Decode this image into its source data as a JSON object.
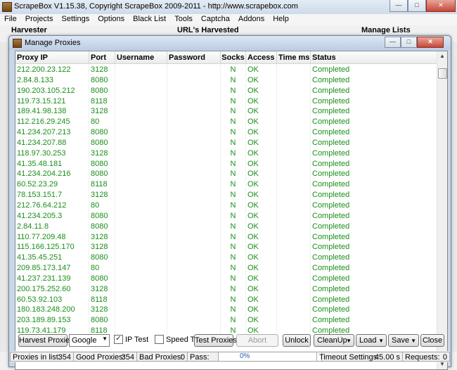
{
  "window": {
    "title": "ScrapeBox V1.15.38, Copyright ScrapeBox 2009-2011 - http://www.scrapebox.com",
    "controls": {
      "minimize": "—",
      "maximize": "□",
      "close": "✕"
    }
  },
  "menu": [
    "File",
    "Projects",
    "Settings",
    "Options",
    "Black List",
    "Tools",
    "Captcha",
    "Addons",
    "Help"
  ],
  "background_panels": {
    "harvester": "Harvester",
    "urls_harvested": "URL's Harvested",
    "manage_lists": "Manage Lists"
  },
  "dialog": {
    "title": "Manage Proxies",
    "controls": {
      "minimize": "—",
      "maximize": "□",
      "close": "✕"
    },
    "columns": [
      "Proxy IP",
      "Port",
      "Username",
      "Password",
      "Socks",
      "Access",
      "Time ms",
      "Status"
    ],
    "rows": [
      {
        "ip": "212.200.23.122",
        "port": "3128",
        "socks": "N",
        "access": "OK",
        "status": "Completed"
      },
      {
        "ip": "2.84.8.133",
        "port": "8080",
        "socks": "N",
        "access": "OK",
        "status": "Completed"
      },
      {
        "ip": "190.203.105.212",
        "port": "8080",
        "socks": "N",
        "access": "OK",
        "status": "Completed"
      },
      {
        "ip": "119.73.15.121",
        "port": "8118",
        "socks": "N",
        "access": "OK",
        "status": "Completed"
      },
      {
        "ip": "189.41.98.138",
        "port": "3128",
        "socks": "N",
        "access": "OK",
        "status": "Completed"
      },
      {
        "ip": "112.216.29.245",
        "port": "80",
        "socks": "N",
        "access": "OK",
        "status": "Completed"
      },
      {
        "ip": "41.234.207.213",
        "port": "8080",
        "socks": "N",
        "access": "OK",
        "status": "Completed"
      },
      {
        "ip": "41.234.207.88",
        "port": "8080",
        "socks": "N",
        "access": "OK",
        "status": "Completed"
      },
      {
        "ip": "118.97.30.253",
        "port": "3128",
        "socks": "N",
        "access": "OK",
        "status": "Completed"
      },
      {
        "ip": "41.35.48.181",
        "port": "8080",
        "socks": "N",
        "access": "OK",
        "status": "Completed"
      },
      {
        "ip": "41.234.204.216",
        "port": "8080",
        "socks": "N",
        "access": "OK",
        "status": "Completed"
      },
      {
        "ip": "60.52.23.29",
        "port": "8118",
        "socks": "N",
        "access": "OK",
        "status": "Completed"
      },
      {
        "ip": "78.153.151.7",
        "port": "3128",
        "socks": "N",
        "access": "OK",
        "status": "Completed"
      },
      {
        "ip": "212.76.64.212",
        "port": "80",
        "socks": "N",
        "access": "OK",
        "status": "Completed"
      },
      {
        "ip": "41.234.205.3",
        "port": "8080",
        "socks": "N",
        "access": "OK",
        "status": "Completed"
      },
      {
        "ip": "2.84.11.8",
        "port": "8080",
        "socks": "N",
        "access": "OK",
        "status": "Completed"
      },
      {
        "ip": "110.77.209.48",
        "port": "3128",
        "socks": "N",
        "access": "OK",
        "status": "Completed"
      },
      {
        "ip": "115.166.125.170",
        "port": "3128",
        "socks": "N",
        "access": "OK",
        "status": "Completed"
      },
      {
        "ip": "41.35.45.251",
        "port": "8080",
        "socks": "N",
        "access": "OK",
        "status": "Completed"
      },
      {
        "ip": "209.85.173.147",
        "port": "80",
        "socks": "N",
        "access": "OK",
        "status": "Completed"
      },
      {
        "ip": "41.237.231.139",
        "port": "8080",
        "socks": "N",
        "access": "OK",
        "status": "Completed"
      },
      {
        "ip": "200.175.252.60",
        "port": "3128",
        "socks": "N",
        "access": "OK",
        "status": "Completed"
      },
      {
        "ip": "60.53.92.103",
        "port": "8118",
        "socks": "N",
        "access": "OK",
        "status": "Completed"
      },
      {
        "ip": "180.183.248.200",
        "port": "3128",
        "socks": "N",
        "access": "OK",
        "status": "Completed"
      },
      {
        "ip": "203.189.89.153",
        "port": "8080",
        "socks": "N",
        "access": "OK",
        "status": "Completed"
      },
      {
        "ip": "119.73.41.179",
        "port": "8118",
        "socks": "N",
        "access": "OK",
        "status": "Completed"
      }
    ],
    "toolbar": {
      "harvest": "Harvest Proxies",
      "engine_select": "Google",
      "ip_test": "IP Test",
      "ip_test_checked": true,
      "speed_test": "Speed Test",
      "speed_test_checked": false,
      "test_proxies": "Test Proxies",
      "abort": "Abort",
      "unlock": "Unlock",
      "cleanup": "CleanUp",
      "load": "Load",
      "save": "Save",
      "close": "Close"
    },
    "status": {
      "proxies_in_list_label": "Proxies in list:",
      "proxies_in_list": "354",
      "good_label": "Good Proxies:",
      "good": "354",
      "bad_label": "Bad Proxies:",
      "bad": "0",
      "pass_label": "Pass:",
      "progress_text": "0%",
      "timeout_label": "Timeout Settings:",
      "timeout_value": "45.00 s",
      "requests_label": "Requests:",
      "requests": "0"
    }
  },
  "colors": {
    "ok_text": "#1a8f1a",
    "progress_text": "#1a5fc0"
  }
}
